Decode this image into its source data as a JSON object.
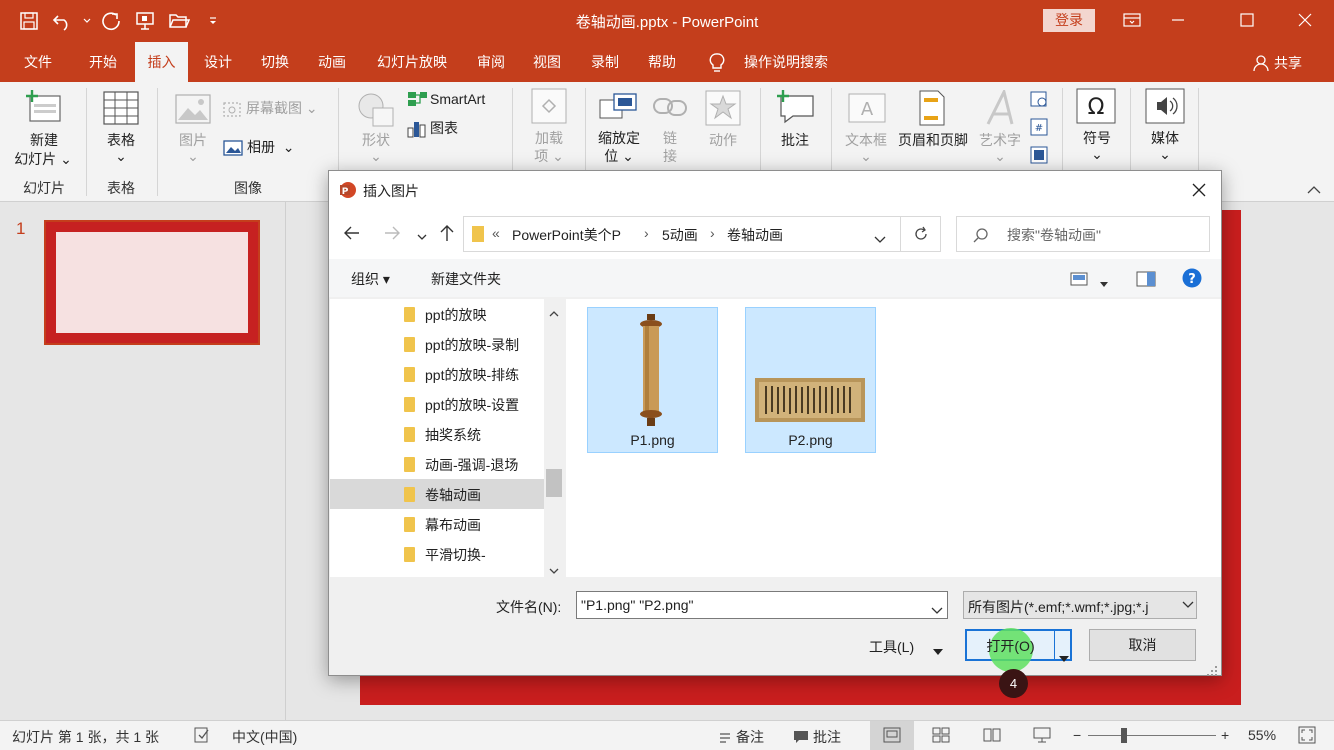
{
  "window": {
    "title": "卷轴动画.pptx  -  PowerPoint",
    "login_label": "登录",
    "share_label": "共享"
  },
  "tabs": [
    "文件",
    "开始",
    "插入",
    "设计",
    "切换",
    "动画",
    "幻灯片放映",
    "审阅",
    "视图",
    "录制",
    "帮助"
  ],
  "active_tab": "插入",
  "tell_me": "操作说明搜索",
  "ribbon": {
    "new_slide_line1": "新建",
    "new_slide_line2": "幻灯片",
    "group_slides": "幻灯片",
    "table_label": "表格",
    "group_tables": "表格",
    "pictures_label": "图片",
    "screenshot_label": "屏幕截图",
    "album_label": "相册",
    "group_images": "图像",
    "shapes_label": "形状",
    "smartart_label": "SmartArt",
    "chart_label": "图表",
    "addins_line1": "加载",
    "addins_line2": "项",
    "zoom_line1": "缩放定",
    "zoom_line2": "位",
    "link_line1": "链",
    "link_line2": "接",
    "action_label": "动作",
    "comment_label": "批注",
    "textbox_label": "文本框",
    "header_footer_label": "页眉和页脚",
    "wordart_label": "艺术字",
    "symbols_label": "符号",
    "media_label": "媒体"
  },
  "thumbnails": {
    "slide_number": "1"
  },
  "dialog": {
    "title": "插入图片",
    "breadcrumb": [
      "«",
      "PowerPoint美个P",
      "5动画",
      "卷轴动画"
    ],
    "search_placeholder": "搜索\"卷轴动画\"",
    "organize_label": "组织",
    "new_folder_label": "新建文件夹",
    "nav_items": [
      "ppt的放映",
      "ppt的放映-录制",
      "ppt的放映-排练",
      "ppt的放映-设置",
      "抽奖系统",
      "动画-强调-退场",
      "卷轴动画",
      "幕布动画",
      "平滑切换-"
    ],
    "selected_nav_item": "卷轴动画",
    "files": [
      {
        "name": "P1.png",
        "icon": "vertical-scroll-icon"
      },
      {
        "name": "P2.png",
        "icon": "calligraphy-scroll-icon"
      }
    ],
    "filename_label": "文件名(N):",
    "filename_value": "\"P1.png\" \"P2.png\"",
    "filetype_value": "所有图片(*.emf;*.wmf;*.jpg;*.j",
    "tools_label": "工具(L)",
    "open_label": "打开(O)",
    "cancel_label": "取消",
    "step_badge": "4"
  },
  "status": {
    "slide_info": "幻灯片 第 1 张，共 1 张",
    "language": "中文(中国)",
    "notes_label": "备注",
    "comments_label": "批注",
    "zoom_minus": "−",
    "zoom_plus": "+",
    "zoom_level": "55%"
  },
  "colors": {
    "accent": "#c43e1c",
    "slide_red": "#c91e1e",
    "selection_blue": "#cce8ff",
    "highlight_green": "#5fe05f"
  }
}
